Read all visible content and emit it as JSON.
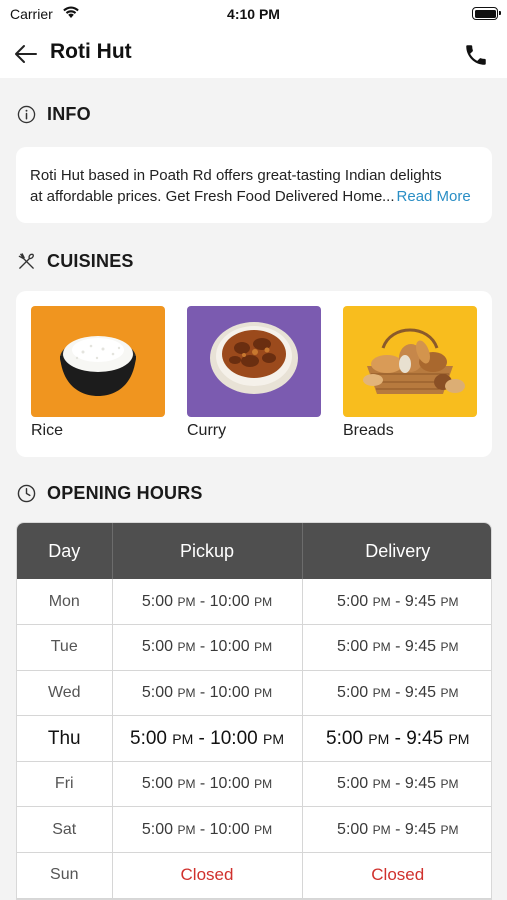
{
  "status_bar": {
    "carrier": "Carrier",
    "time": "4:10 PM"
  },
  "nav": {
    "title": "Roti Hut"
  },
  "info": {
    "heading": "INFO",
    "line1": "Roti Hut based in Poath Rd offers great-tasting Indian delights",
    "line2": "at affordable prices. Get Fresh Food Delivered Home",
    "ellipsis": "...",
    "read_more": "Read More"
  },
  "cuisines": {
    "heading": "CUISINES",
    "items": [
      {
        "label": "Rice",
        "tile_color": "#f0951f"
      },
      {
        "label": "Curry",
        "tile_color": "#7b5bb0"
      },
      {
        "label": "Breads",
        "tile_color": "#f8bd1e"
      }
    ]
  },
  "opening_hours": {
    "heading": "OPENING HOURS",
    "columns": [
      "Day",
      "Pickup",
      "Delivery"
    ],
    "rows": [
      {
        "day": "Mon",
        "pickup_open": "5:00",
        "pickup_open_ampm": "PM",
        "pickup_close": "10:00",
        "pickup_close_ampm": "PM",
        "delivery_open": "5:00",
        "delivery_open_ampm": "PM",
        "delivery_close": "9:45",
        "delivery_close_ampm": "PM"
      },
      {
        "day": "Tue",
        "pickup_open": "5:00",
        "pickup_open_ampm": "PM",
        "pickup_close": "10:00",
        "pickup_close_ampm": "PM",
        "delivery_open": "5:00",
        "delivery_open_ampm": "PM",
        "delivery_close": "9:45",
        "delivery_close_ampm": "PM"
      },
      {
        "day": "Wed",
        "pickup_open": "5:00",
        "pickup_open_ampm": "PM",
        "pickup_close": "10:00",
        "pickup_close_ampm": "PM",
        "delivery_open": "5:00",
        "delivery_open_ampm": "PM",
        "delivery_close": "9:45",
        "delivery_close_ampm": "PM"
      },
      {
        "day": "Thu",
        "pickup_open": "5:00",
        "pickup_open_ampm": "PM",
        "pickup_close": "10:00",
        "pickup_close_ampm": "PM",
        "delivery_open": "5:00",
        "delivery_open_ampm": "PM",
        "delivery_close": "9:45",
        "delivery_close_ampm": "PM"
      },
      {
        "day": "Fri",
        "pickup_open": "5:00",
        "pickup_open_ampm": "PM",
        "pickup_close": "10:00",
        "pickup_close_ampm": "PM",
        "delivery_open": "5:00",
        "delivery_open_ampm": "PM",
        "delivery_close": "9:45",
        "delivery_close_ampm": "PM"
      },
      {
        "day": "Sat",
        "pickup_open": "5:00",
        "pickup_open_ampm": "PM",
        "pickup_close": "10:00",
        "pickup_close_ampm": "PM",
        "delivery_open": "5:00",
        "delivery_open_ampm": "PM",
        "delivery_close": "9:45",
        "delivery_close_ampm": "PM"
      },
      {
        "day": "Sun",
        "pickup_closed": "Closed",
        "delivery_closed": "Closed"
      }
    ],
    "closed_color": "#d0312d",
    "header_color": "#4f4f4f"
  }
}
